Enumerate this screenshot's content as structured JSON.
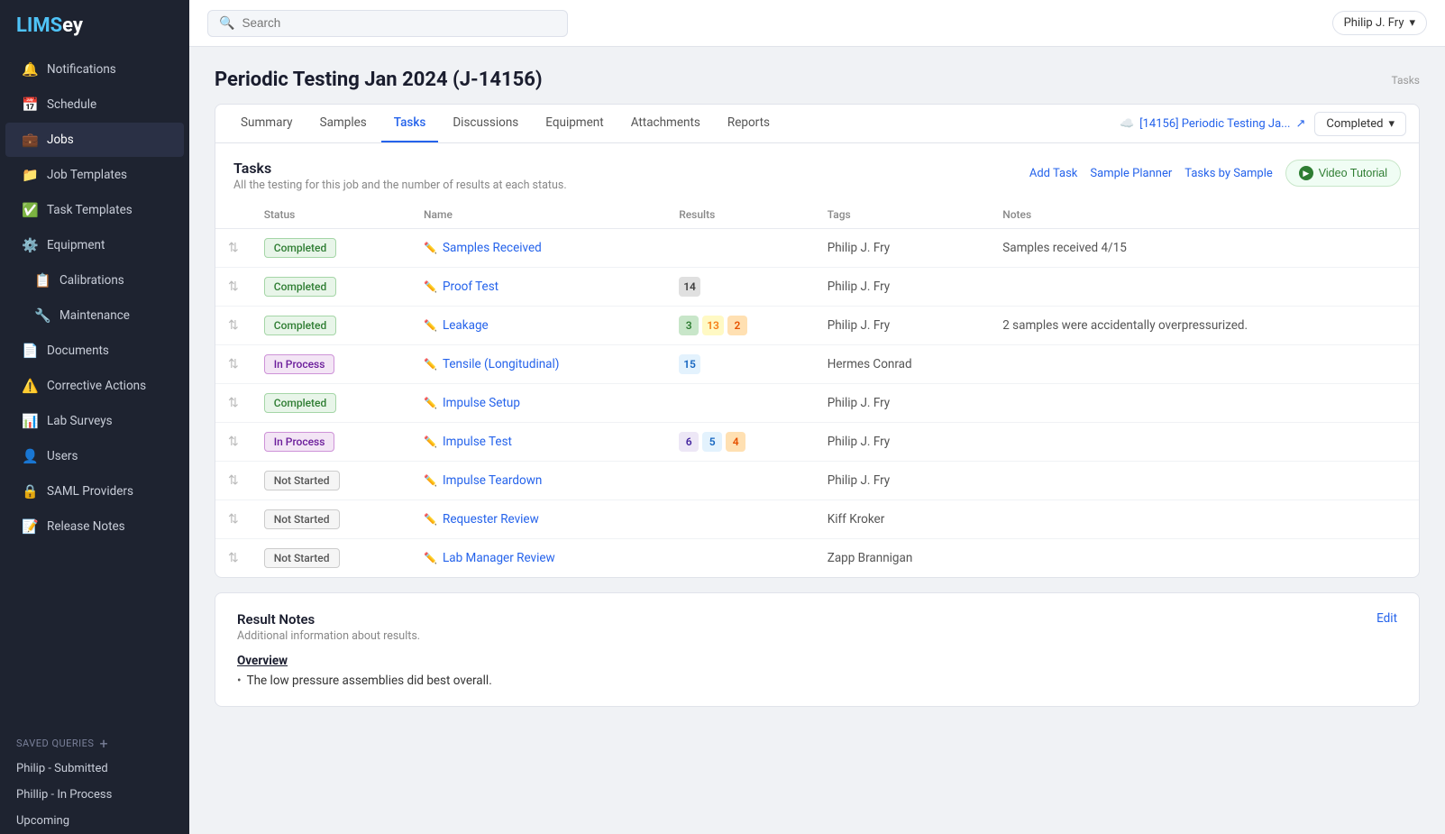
{
  "app": {
    "name_lims": "LIMS",
    "name_ey": "ey"
  },
  "topbar": {
    "search_placeholder": "Search",
    "user_label": "Philip J. Fry",
    "user_chevron": "▾"
  },
  "sidebar": {
    "nav_items": [
      {
        "id": "notifications",
        "label": "Notifications",
        "icon": "🔔"
      },
      {
        "id": "schedule",
        "label": "Schedule",
        "icon": "📅"
      },
      {
        "id": "jobs",
        "label": "Jobs",
        "icon": "💼",
        "active": true
      },
      {
        "id": "job-templates",
        "label": "Job Templates",
        "icon": "📁"
      },
      {
        "id": "task-templates",
        "label": "Task Templates",
        "icon": "✅"
      },
      {
        "id": "equipment",
        "label": "Equipment",
        "icon": "⚙️"
      },
      {
        "id": "calibrations",
        "label": "Calibrations",
        "icon": "📋",
        "indent": true
      },
      {
        "id": "maintenance",
        "label": "Maintenance",
        "icon": "🔧",
        "indent": true
      },
      {
        "id": "documents",
        "label": "Documents",
        "icon": "📄"
      },
      {
        "id": "corrective-actions",
        "label": "Corrective Actions",
        "icon": "⚠️"
      },
      {
        "id": "lab-surveys",
        "label": "Lab Surveys",
        "icon": "📊"
      },
      {
        "id": "users",
        "label": "Users",
        "icon": "👤"
      },
      {
        "id": "saml-providers",
        "label": "SAML Providers",
        "icon": "🔒"
      },
      {
        "id": "release-notes",
        "label": "Release Notes",
        "icon": "📝"
      }
    ],
    "saved_queries_label": "Saved Queries",
    "saved_queries_add_icon": "+",
    "saved_queries": [
      {
        "id": "philip-submitted",
        "label": "Philip - Submitted"
      },
      {
        "id": "phillip-in-process",
        "label": "Phillip - In Process"
      },
      {
        "id": "upcoming",
        "label": "Upcoming"
      }
    ]
  },
  "page": {
    "title": "Periodic Testing Jan 2024 (J-14156)",
    "top_right_label": "Tasks"
  },
  "tabs": [
    {
      "id": "summary",
      "label": "Summary",
      "active": false
    },
    {
      "id": "samples",
      "label": "Samples",
      "active": false
    },
    {
      "id": "tasks",
      "label": "Tasks",
      "active": true
    },
    {
      "id": "discussions",
      "label": "Discussions",
      "active": false
    },
    {
      "id": "equipment",
      "label": "Equipment",
      "active": false
    },
    {
      "id": "attachments",
      "label": "Attachments",
      "active": false
    },
    {
      "id": "reports",
      "label": "Reports",
      "active": false
    }
  ],
  "job_link": {
    "label": "[14156] Periodic Testing Ja...",
    "icon": "☁️",
    "external_icon": "↗"
  },
  "status_dropdown": {
    "label": "Completed",
    "chevron": "▾"
  },
  "tasks_section": {
    "title": "Tasks",
    "subtitle": "All the testing for this job and the number of results at each status.",
    "add_task_label": "Add Task",
    "sample_planner_label": "Sample Planner",
    "tasks_by_sample_label": "Tasks by Sample",
    "video_tutorial_label": "Video Tutorial",
    "columns": [
      {
        "id": "status",
        "label": "Status"
      },
      {
        "id": "name",
        "label": "Name"
      },
      {
        "id": "results",
        "label": "Results"
      },
      {
        "id": "tags",
        "label": "Tags"
      },
      {
        "id": "notes",
        "label": "Notes"
      }
    ],
    "rows": [
      {
        "id": "row-1",
        "status": "Completed",
        "status_type": "completed",
        "name": "Samples Received",
        "results": [],
        "tags": "Philip J. Fry",
        "notes": "Samples received 4/15"
      },
      {
        "id": "row-2",
        "status": "Completed",
        "status_type": "completed",
        "name": "Proof Test",
        "results": [
          {
            "value": "14",
            "type": "gray"
          }
        ],
        "tags": "Philip J. Fry",
        "notes": ""
      },
      {
        "id": "row-3",
        "status": "Completed",
        "status_type": "completed",
        "name": "Leakage",
        "results": [
          {
            "value": "3",
            "type": "green"
          },
          {
            "value": "13",
            "type": "yellow"
          },
          {
            "value": "2",
            "type": "orange"
          }
        ],
        "tags": "Philip J. Fry",
        "notes": "2 samples were accidentally overpressurized."
      },
      {
        "id": "row-4",
        "status": "In Process",
        "status_type": "in-process",
        "name": "Tensile (Longitudinal)",
        "results": [
          {
            "value": "15",
            "type": "blue"
          }
        ],
        "tags": "Hermes Conrad",
        "notes": ""
      },
      {
        "id": "row-5",
        "status": "Completed",
        "status_type": "completed",
        "name": "Impulse Setup",
        "results": [],
        "tags": "Philip J. Fry",
        "notes": ""
      },
      {
        "id": "row-6",
        "status": "In Process",
        "status_type": "in-process",
        "name": "Impulse Test",
        "results": [
          {
            "value": "6",
            "type": "purple"
          },
          {
            "value": "5",
            "type": "blue"
          },
          {
            "value": "4",
            "type": "orange"
          }
        ],
        "tags": "Philip J. Fry",
        "notes": ""
      },
      {
        "id": "row-7",
        "status": "Not Started",
        "status_type": "not-started",
        "name": "Impulse Teardown",
        "results": [],
        "tags": "Philip J. Fry",
        "notes": ""
      },
      {
        "id": "row-8",
        "status": "Not Started",
        "status_type": "not-started",
        "name": "Requester Review",
        "results": [],
        "tags": "Kiff Kroker",
        "notes": ""
      },
      {
        "id": "row-9",
        "status": "Not Started",
        "status_type": "not-started",
        "name": "Lab Manager Review",
        "results": [],
        "tags": "Zapp Brannigan",
        "notes": ""
      }
    ]
  },
  "result_notes": {
    "title": "Result Notes",
    "subtitle": "Additional information about results.",
    "edit_label": "Edit",
    "overview_title": "Overview",
    "overview_items": [
      "The low pressure assemblies did best overall."
    ]
  }
}
